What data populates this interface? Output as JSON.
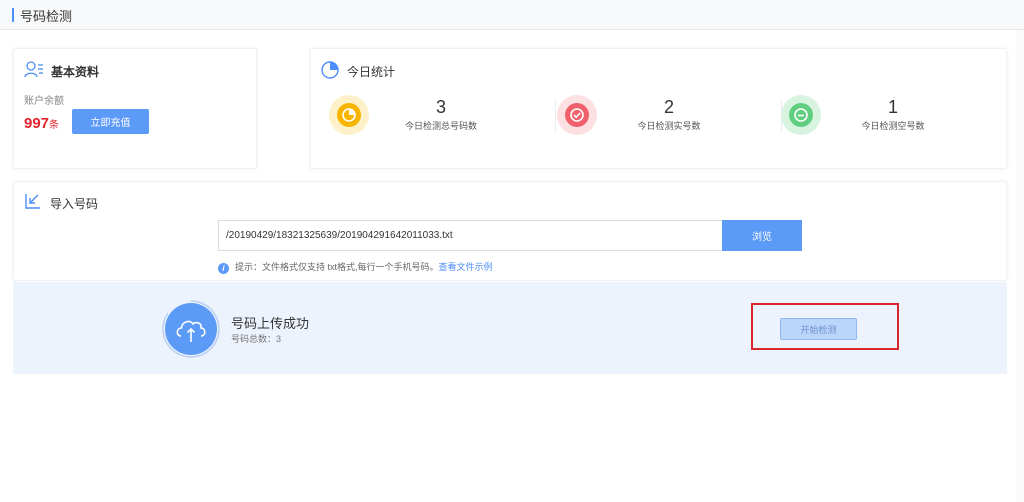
{
  "page": {
    "title": "号码检测"
  },
  "basic_info": {
    "title": "基本资料",
    "balance_label": "账户余额",
    "balance_value": "997",
    "balance_unit": "条",
    "recharge_label": "立即充值"
  },
  "today_stats": {
    "title": "今日统计",
    "items": [
      {
        "value": "3",
        "label": "今日检测总号码数",
        "color": "#f7b500"
      },
      {
        "value": "2",
        "label": "今日检测实号数",
        "color": "#f0616c"
      },
      {
        "value": "1",
        "label": "今日检测空号数",
        "color": "#5fcf7f"
      }
    ]
  },
  "import": {
    "title": "导入号码",
    "file_path": "/20190429/18321325639/201904291642011033.txt",
    "browse_label": "浏览",
    "hint_text": "提示：文件格式仅支持 txt格式,每行一个手机号码。",
    "hint_link": "查看文件示例"
  },
  "upload_result": {
    "title": "号码上传成功",
    "count_text": "号码总数：3",
    "start_label": "开始检测"
  },
  "colors": {
    "accent": "#5b9af7",
    "highlight": "#d9262c",
    "balance": "#e0262c"
  }
}
